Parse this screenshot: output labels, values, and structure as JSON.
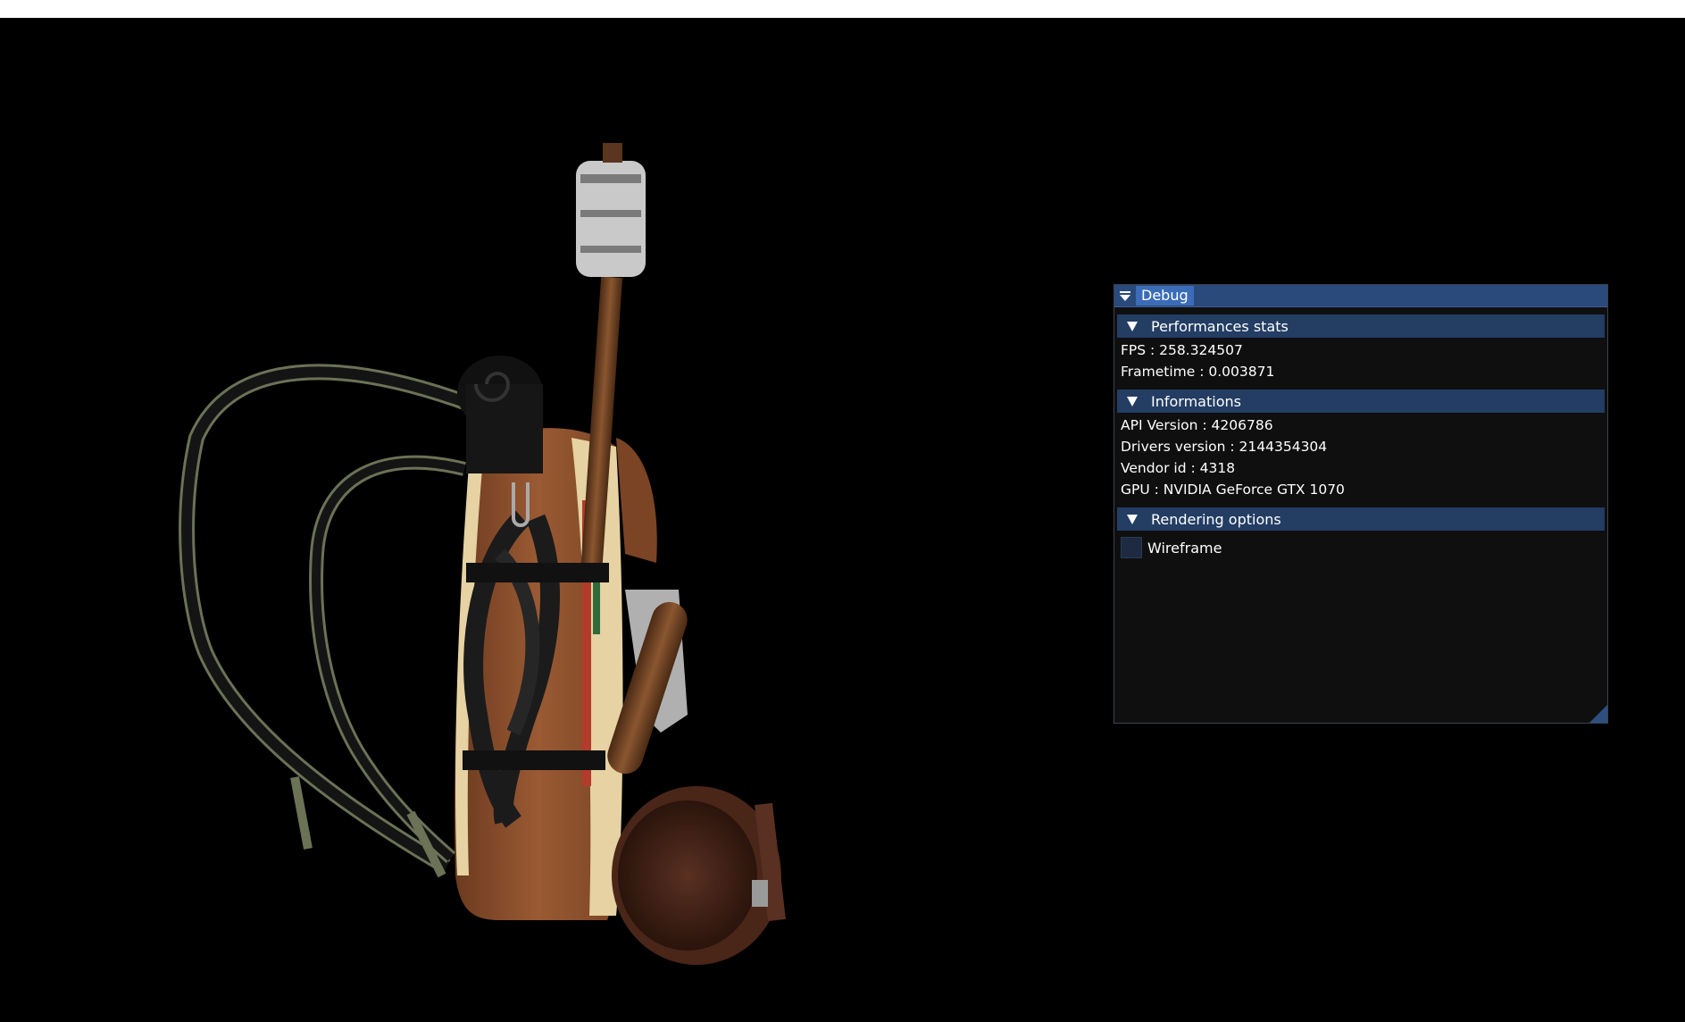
{
  "window": {
    "title": "Debug"
  },
  "sections": {
    "performance": {
      "label": "Performances stats",
      "fps": "FPS : 258.324507",
      "frametime": "Frametime : 0.003871"
    },
    "informations": {
      "label": "Informations",
      "api_version": "API Version : 4206786",
      "drivers_version": "Drivers version : 2144354304",
      "vendor_id": "Vendor id : 4318",
      "gpu": "GPU : NVIDIA GeForce GTX 1070"
    },
    "rendering": {
      "label": "Rendering options",
      "wireframe_label": "Wireframe",
      "wireframe_checked": false
    }
  },
  "colors": {
    "background": "#000000",
    "panel_bg": "#0f0f0f",
    "title_bg": "#294a7a",
    "title_active": "#3b6cb8",
    "header_bg": "#233d63",
    "checkbox_bg": "#1e2a40"
  },
  "icons": {
    "collapse": "triangle-down-icon",
    "section_open": "triangle-down-icon"
  }
}
